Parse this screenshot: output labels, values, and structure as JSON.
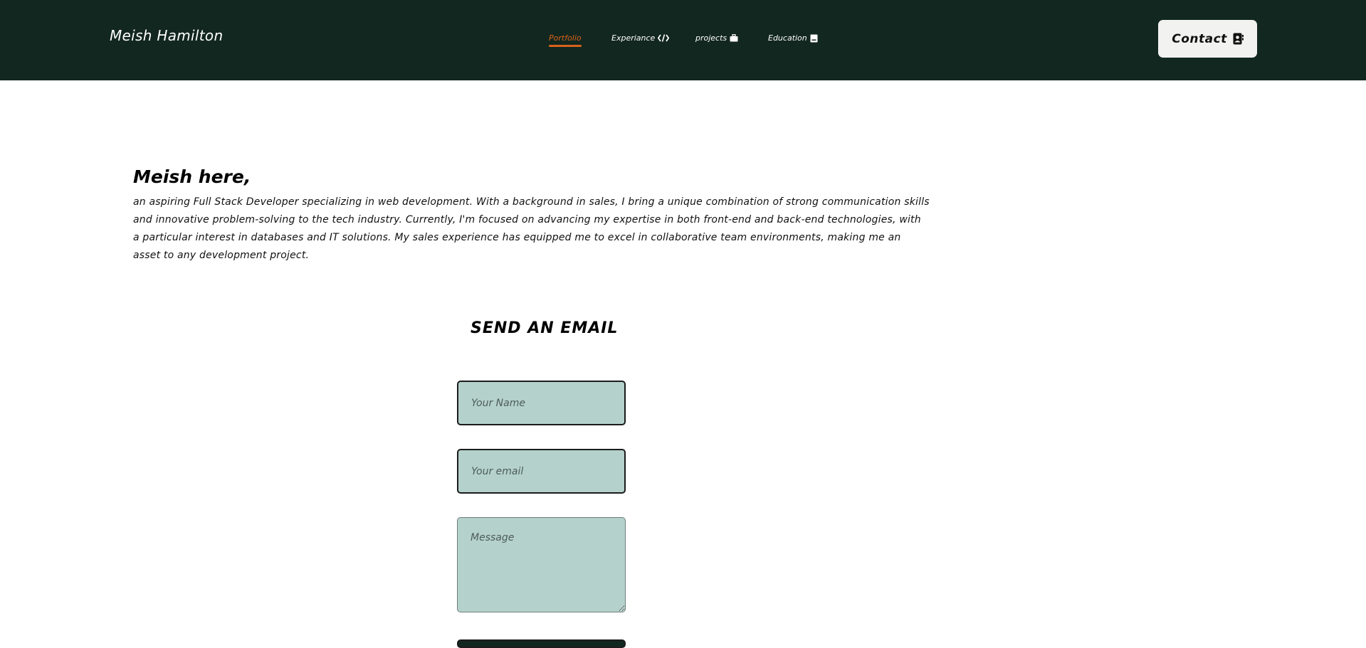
{
  "navbar": {
    "brand": "Meish Hamilton",
    "links": [
      {
        "label": "Portfolio",
        "icon": "",
        "active": true
      },
      {
        "label": "Experiance",
        "icon": "code-icon",
        "active": false
      },
      {
        "label": "projects",
        "icon": "briefcase-icon",
        "active": false
      },
      {
        "label": "Education",
        "icon": "book-icon",
        "active": false
      }
    ],
    "contact_label": "Contact",
    "contact_icon": "contact-card-icon"
  },
  "hero": {
    "title": "Meish here,",
    "text": "an aspiring Full Stack Developer specializing in web development. With a background in sales, I bring a unique combination of strong communication skills and innovative problem-solving to the tech industry. Currently, I'm focused on advancing my expertise in both front-end and back-end technologies, with a particular interest in databases and IT solutions. My sales experience has equipped me to excel in collaborative team environments, making me an asset to any development project."
  },
  "form": {
    "title": "SEND AN EMAIL",
    "name_placeholder": "Your Name",
    "email_placeholder": "Your email",
    "message_placeholder": "Message"
  },
  "colors": {
    "navbar_bg": "#12271f",
    "accent": "#d9621c",
    "field_bg": "#b4d1cb",
    "button_bg": "#f2f2f0"
  }
}
